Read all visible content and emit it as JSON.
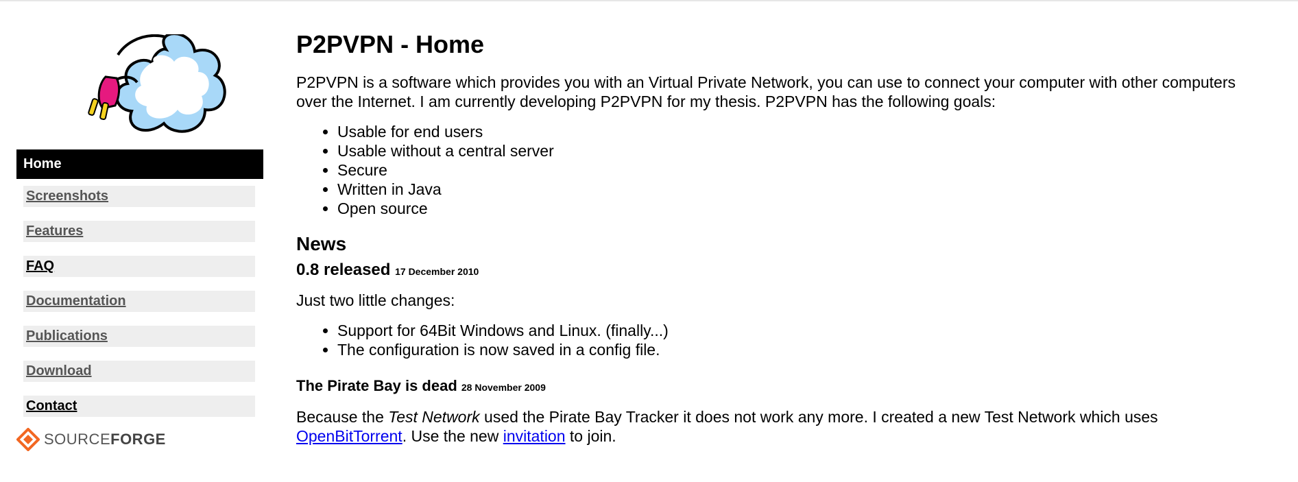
{
  "sidebar": {
    "nav": [
      {
        "label": "Home",
        "active": true
      },
      {
        "label": "Screenshots"
      },
      {
        "label": "Features"
      },
      {
        "label": "FAQ"
      },
      {
        "label": "Documentation"
      },
      {
        "label": "Publications"
      },
      {
        "label": "Download"
      },
      {
        "label": "Contact"
      }
    ],
    "sourceforge": {
      "prefix": "SOURCE",
      "suffix": "FORGE"
    }
  },
  "main": {
    "title": "P2PVPN - Home",
    "intro": "P2PVPN is a software which provides you with an Virtual Private Network, you can use to connect your computer with other computers over the Internet. I am currently developing P2PVPN for my thesis. P2PVPN has the following goals:",
    "goals": [
      "Usable for end users",
      "Usable without a central server",
      "Secure",
      "Written in Java",
      "Open source"
    ],
    "news_heading": "News",
    "news": [
      {
        "title": "0.8 released",
        "date": "17 December 2010",
        "text": "Just two little changes:",
        "items": [
          "Support for 64Bit Windows and Linux. (finally...)",
          "The configuration is now saved in a config file."
        ]
      },
      {
        "title": "The Pirate Bay is dead",
        "date": "28 November 2009",
        "text_a": "Because the ",
        "text_em": "Test Network",
        "text_b": " used the Pirate Bay Tracker it does not work any more. I created a new Test Network which uses ",
        "link1": "OpenBitTorrent",
        "text_c": ". Use the new ",
        "link2": "invitation",
        "text_d": " to join."
      }
    ]
  },
  "colors": {
    "active_bg": "#000000",
    "item_bg": "#eeeeee",
    "link": "#0000ee",
    "sf_orange": "#f26722"
  }
}
